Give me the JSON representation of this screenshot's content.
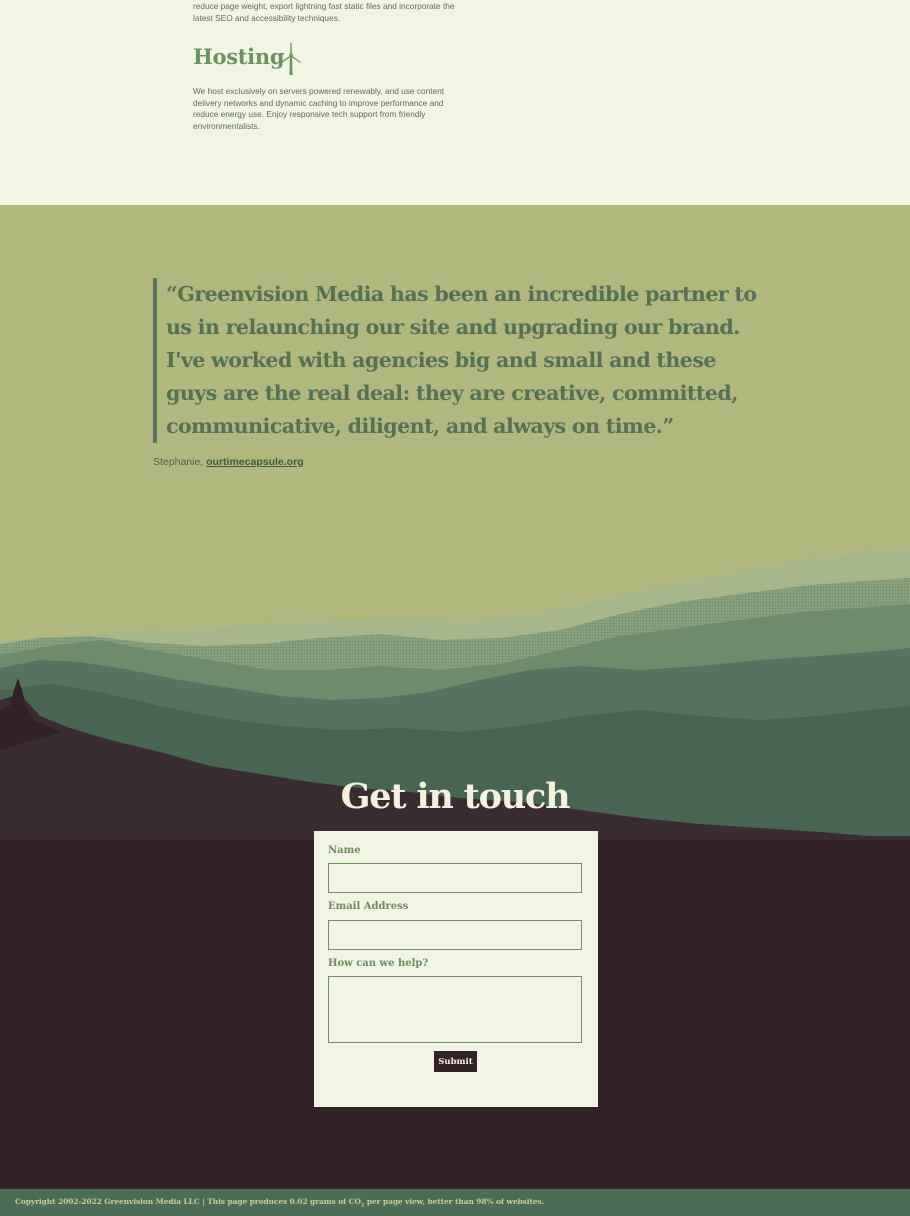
{
  "services": {
    "seo_paragraph": "reduce page weight, export lightning fast static files and incorporate the latest SEO and accessibility techniques.",
    "hosting_title": "Hosting",
    "hosting_icon": "wind-turbine-icon",
    "hosting_paragraph": "We host exclusively on servers powered renewably, and use content delivery networks and dynamic caching to improve performance and reduce energy use. Enjoy responsive tech support from friendly environmentalists."
  },
  "testimonial": {
    "quote": "“Greenvision Media has been an incredible partner to us in relaunching our site and upgrading our brand. I've worked with agencies big and small and these guys are the real deal: they are creative, committed, communicative, diligent, and always on time.”",
    "author": "Stephanie, ",
    "link_text": "ourtimecapsule.org"
  },
  "contact": {
    "title": "Get in touch",
    "name_label": "Name",
    "name_value": "",
    "email_label": "Email Address",
    "email_value": "",
    "help_label": "How can we help?",
    "help_value": "",
    "submit_label": "Submit"
  },
  "footer": {
    "text_before_sub": "Copyright 2002-2022 Greenvision Media LLC | This page produces 0.02 grams of CO",
    "sub": "2",
    "text_after_sub": " per page view, better than 98% of websites."
  },
  "colors": {
    "cream": "#f2f4e4",
    "olive": "#b0b87d",
    "forest": "#577154",
    "plum": "#322227",
    "footer_green": "#4c6d55"
  }
}
